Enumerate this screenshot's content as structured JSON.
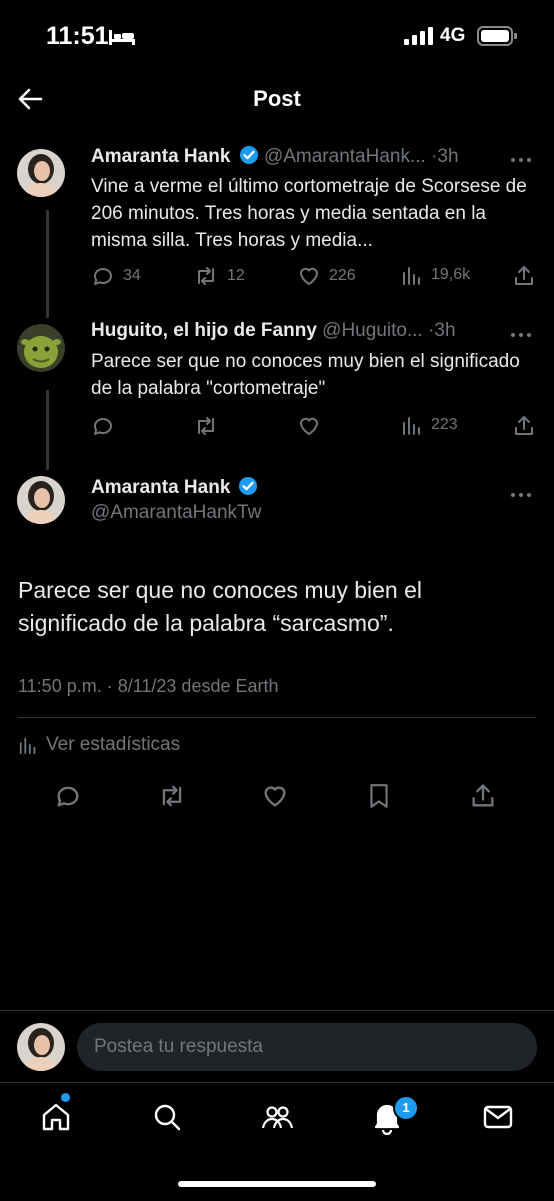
{
  "status_bar": {
    "time": "11:51",
    "network": "4G"
  },
  "header": {
    "title": "Post"
  },
  "thread": [
    {
      "name": "Amaranta Hank",
      "handle": "@AmarantaHank...",
      "time": "·3h",
      "text": "Vine a verme el último cortometraje de Scorsese de 206 minutos. Tres horas y media sentada en la misma silla. Tres horas y media...",
      "replies": "34",
      "reposts": "12",
      "likes": "226",
      "views": "19,6k"
    },
    {
      "name": "Huguito, el hijo de Fanny",
      "handle": "@Huguito...",
      "time": "·3h",
      "text": "Parece ser que no conoces muy bien el significado de la palabra \"cortometraje\"",
      "views": "223"
    }
  ],
  "main_post": {
    "name": "Amaranta Hank",
    "handle": "@AmarantaHankTw",
    "text": "Parece ser que no conoces muy bien el significado de la palabra “sarcasmo”.",
    "meta": "11:50 p.m. · 8/11/23 desde Earth",
    "stats_label": "Ver estadísticas"
  },
  "reply": {
    "placeholder": "Postea tu respuesta"
  },
  "tabbar": {
    "notifications_badge": "1"
  },
  "colors": {
    "accent": "#1d9bf0",
    "muted": "#71767b",
    "text": "#e7e9ea",
    "background": "#000000"
  }
}
